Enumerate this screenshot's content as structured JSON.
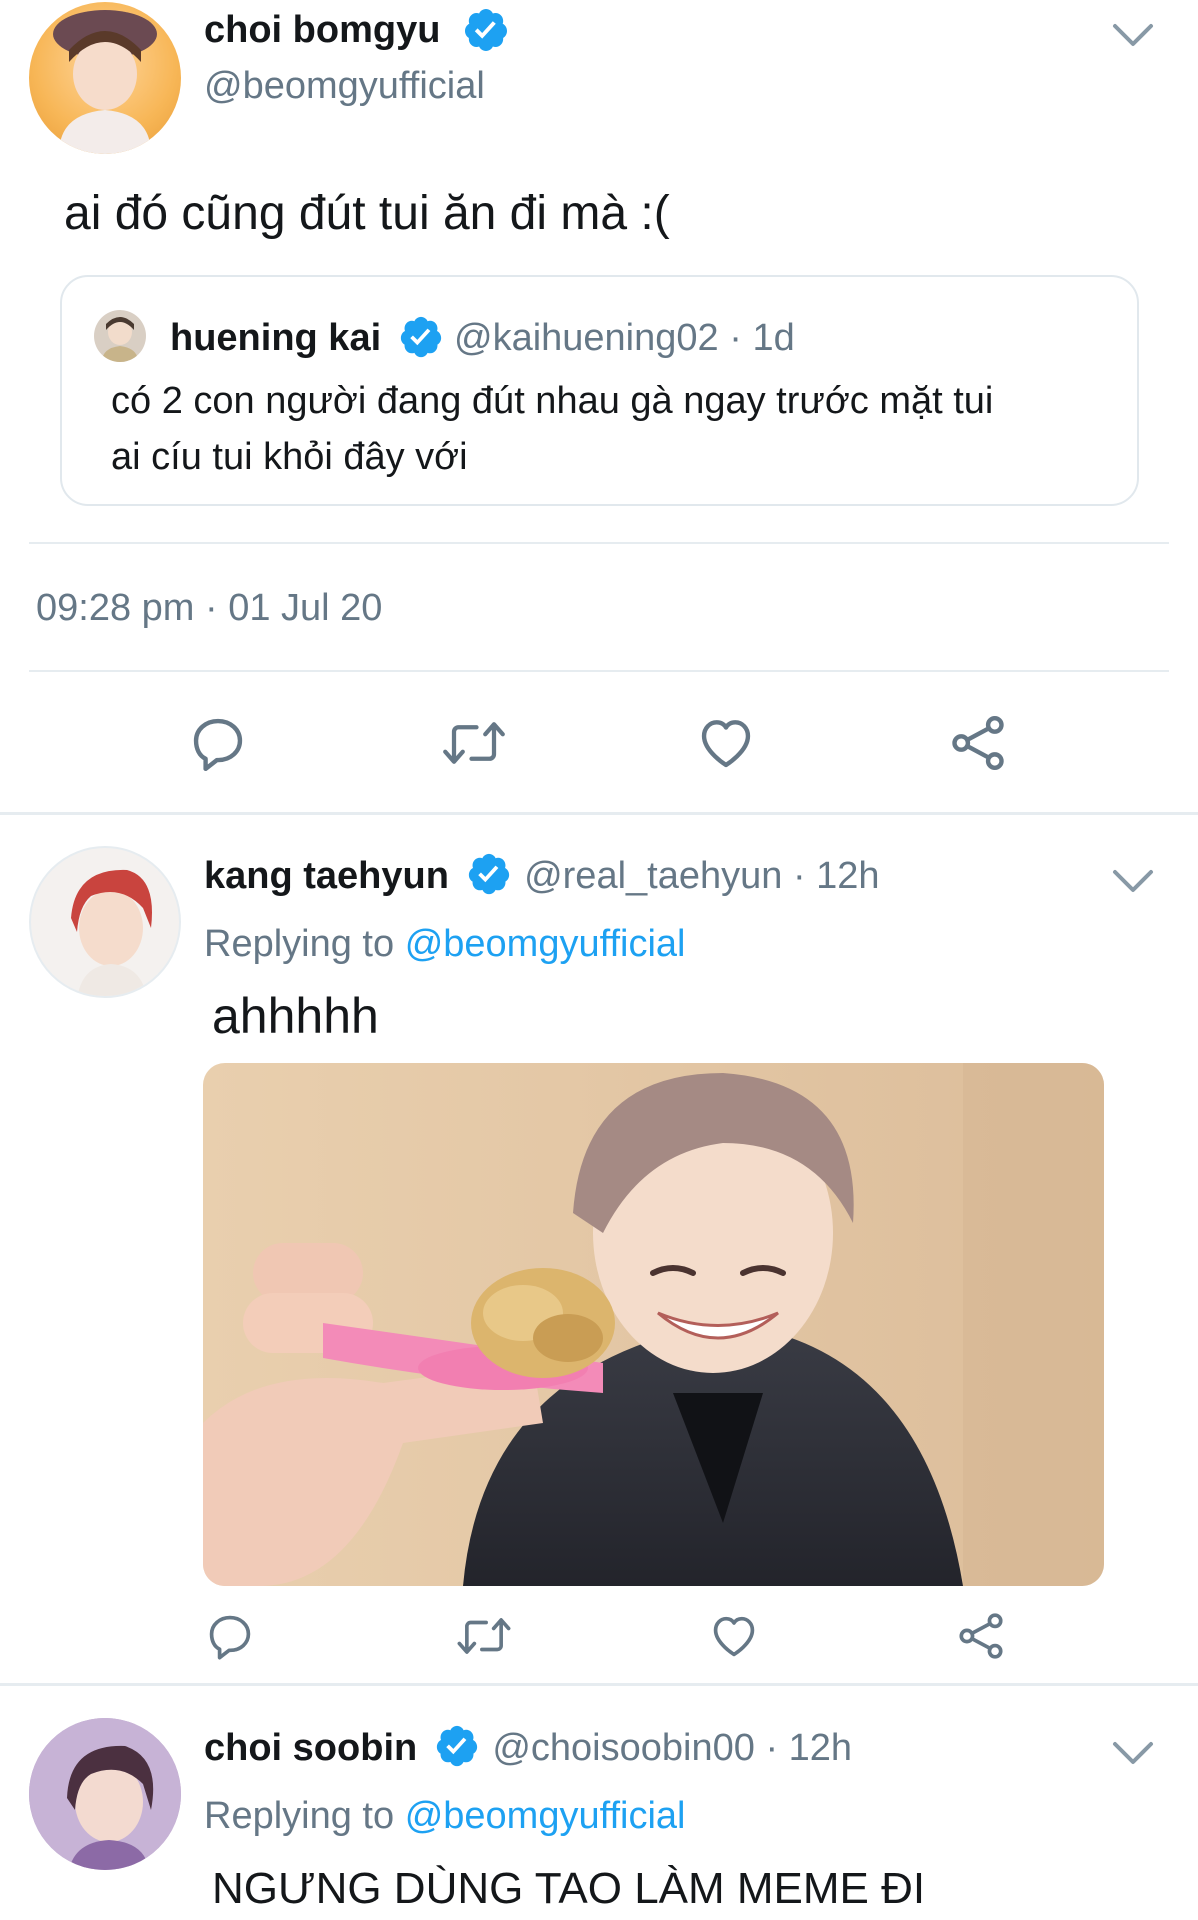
{
  "main_tweet": {
    "author_name": "choi bomgyu",
    "author_handle": "@beomgyufficial",
    "text": "ai đó cũng đút tui ăn đi mà :(",
    "timestamp": "09:28 pm · 01 Jul 20",
    "quoted": {
      "author_name": "huening kai",
      "author_handle": "@kaihuening02",
      "age": "· 1d",
      "line1": "có 2 con người đang đút nhau gà ngay trước mặt tui",
      "line2": "ai cíu tui khỏi đây với"
    }
  },
  "replies": [
    {
      "author_name": "kang taehyun",
      "author_handle": "@real_taehyun",
      "age": "· 12h",
      "replying_label": "Replying to",
      "replying_to": "@beomgyufficial",
      "text": "ahhhhh"
    },
    {
      "author_name": "choi soobin",
      "author_handle": "@choisoobin00",
      "age": "· 12h",
      "replying_label": "Replying to",
      "replying_to": "@beomgyufficial",
      "text": "NGƯNG DÙNG TAO LÀM MEME ĐI"
    }
  ],
  "icons": {
    "reply": "reply-icon",
    "retweet": "retweet-icon",
    "like": "like-icon",
    "share": "share-icon",
    "verified": "verified-badge-icon",
    "more": "chevron-down-icon"
  },
  "colors": {
    "accent": "#1da1f2",
    "muted": "#657786",
    "icon": "#657786",
    "divider": "#e6ecf0"
  }
}
